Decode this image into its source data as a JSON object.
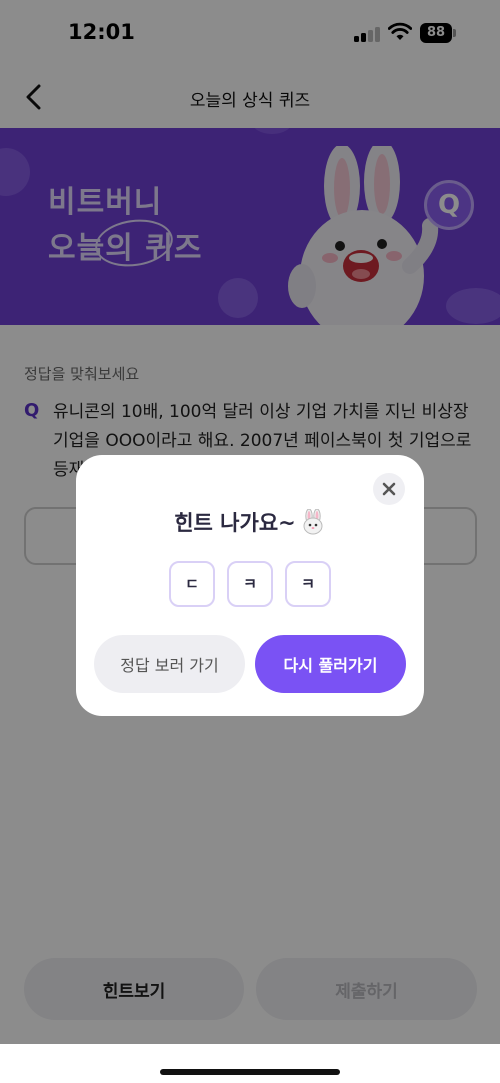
{
  "status_bar": {
    "time": "12:01",
    "battery": "88"
  },
  "nav": {
    "title": "오늘의 상식 퀴즈",
    "back_icon": "chevron-left-icon"
  },
  "banner": {
    "title_line1": "비트버니",
    "title_line2": "오늘의 퀴즈",
    "badge": "Q",
    "background_color": "#6f40d6"
  },
  "quiz": {
    "instruction": "정답을 맞춰보세요",
    "q_mark": "Q",
    "question": "유니콘의 10배, 100억 달러 이상 기업 가치를 지닌 비상장 기업을 OOO이라고 해요. 2007년 페이스북이 첫 기업으로 등재",
    "answer_value": ""
  },
  "bottom_buttons": {
    "hint_label": "힌트보기",
    "submit_label": "제출하기"
  },
  "modal": {
    "title": "힌트 나가요~",
    "title_emoji": "rabbit-face-icon",
    "close_icon": "close-icon",
    "hints": [
      "ㄷ",
      "ㅋ",
      "ㅋ"
    ],
    "view_answer_label": "정답 보러 가기",
    "retry_label": "다시 풀러가기",
    "accent_color": "#7a52f4"
  }
}
